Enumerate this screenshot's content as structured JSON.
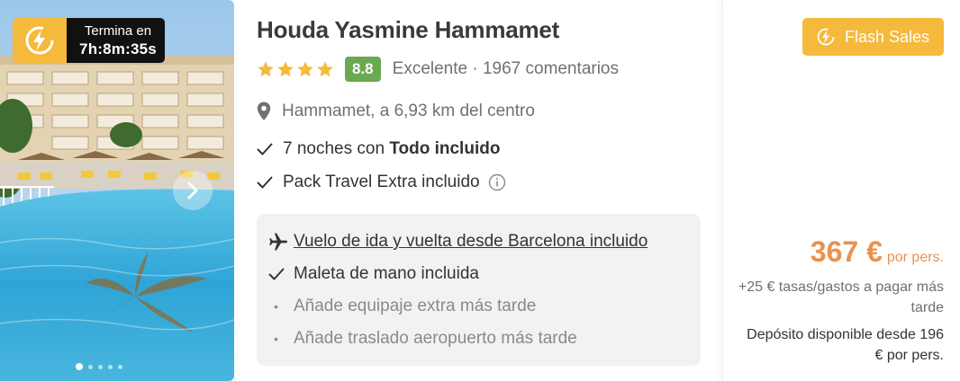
{
  "colors": {
    "accent": "#f5b93b",
    "price": "#e8914f",
    "score_bg": "#6ba84f",
    "timer_bg": "#111111",
    "box_bg": "#f2f2f2"
  },
  "image": {
    "timer_label": "Termina en",
    "timer_value": "7h:8m:35s",
    "timer_icon": "lightning-bolt-icon",
    "next_icon": "chevron-right-icon",
    "gallery_dots": 5,
    "active_dot": 1
  },
  "hotel": {
    "name": "Houda Yasmine Hammamet",
    "stars": 4,
    "score": "8.8",
    "rating_text": "Excelente · 1967 comentarios",
    "location": "Hammamet, a 6,93 km del centro",
    "features": {
      "nights_prefix": "7 noches con ",
      "nights_bold": "Todo incluido",
      "pack": "Pack Travel Extra incluido"
    }
  },
  "flight_box": {
    "flight": "Vuelo de ida y vuelta desde Barcelona incluido",
    "luggage": "Maleta de mano incluida",
    "extra_luggage": "Añade equipaje extra más tarde",
    "transfer": "Añade traslado aeropuerto más tarde"
  },
  "pricing": {
    "badge": "Flash Sales",
    "amount": "367 €",
    "per": "por pers.",
    "taxes": "+25 € tasas/gastos a pagar más tarde",
    "deposit": "Depósito disponible desde 196 € por pers."
  }
}
